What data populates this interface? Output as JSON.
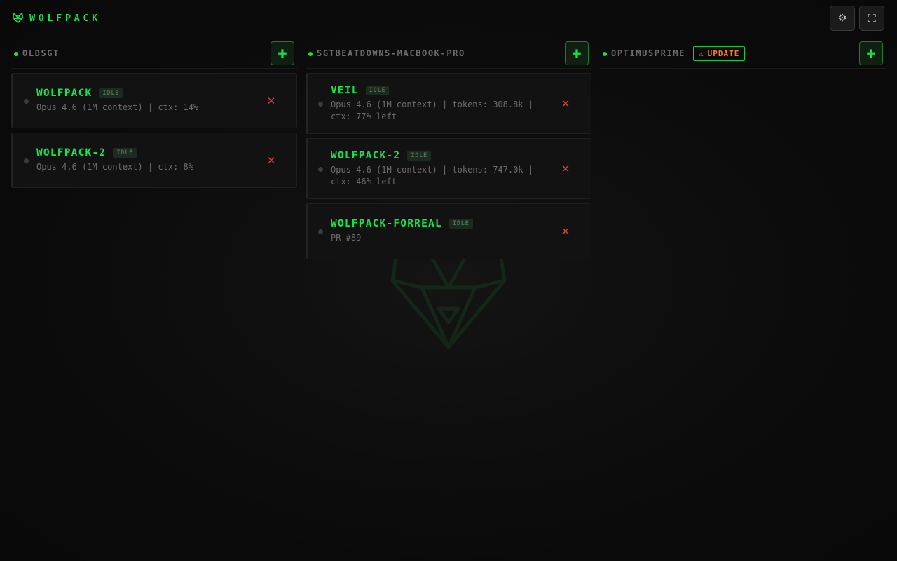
{
  "app": {
    "title": "WOLFPACK"
  },
  "toolbar": {
    "settings_icon": "⚙",
    "fullscreen_icon": "⛶"
  },
  "columns": [
    {
      "host": "OLDSGT",
      "add_icon": "✚",
      "sessions": [
        {
          "name": "WOLFPACK",
          "status": "IDLE",
          "detail": "Opus 4.6 (1M context) | ctx: 14%",
          "close_icon": "✕"
        },
        {
          "name": "WOLFPACK-2",
          "status": "IDLE",
          "detail": "Opus 4.6 (1M context) | ctx: 8%",
          "close_icon": "✕"
        }
      ]
    },
    {
      "host": "SGTBEATDOWNS-MACBOOK-PRO",
      "add_icon": "✚",
      "sessions": [
        {
          "name": "VEIL",
          "status": "IDLE",
          "detail": "Opus 4.6 (1M context) | tokens: 308.8k | ctx: 77% left",
          "close_icon": "✕"
        },
        {
          "name": "WOLFPACK-2",
          "status": "IDLE",
          "detail": "Opus 4.6 (1M context) | tokens: 747.0k | ctx: 46% left",
          "close_icon": "✕"
        },
        {
          "name": "WOLFPACK-FORREAL",
          "status": "IDLE",
          "detail": "PR #89",
          "close_icon": "✕"
        }
      ]
    },
    {
      "host": "OPTIMUSPRIME",
      "update": {
        "icon": "⚠",
        "label": "UPDATE"
      },
      "add_icon": "✚",
      "sessions": []
    }
  ],
  "colors": {
    "accent_green": "#19e34a",
    "danger_red": "#e03a3a",
    "update_orange": "#ff7a1f",
    "background": "#0b0b0b"
  }
}
